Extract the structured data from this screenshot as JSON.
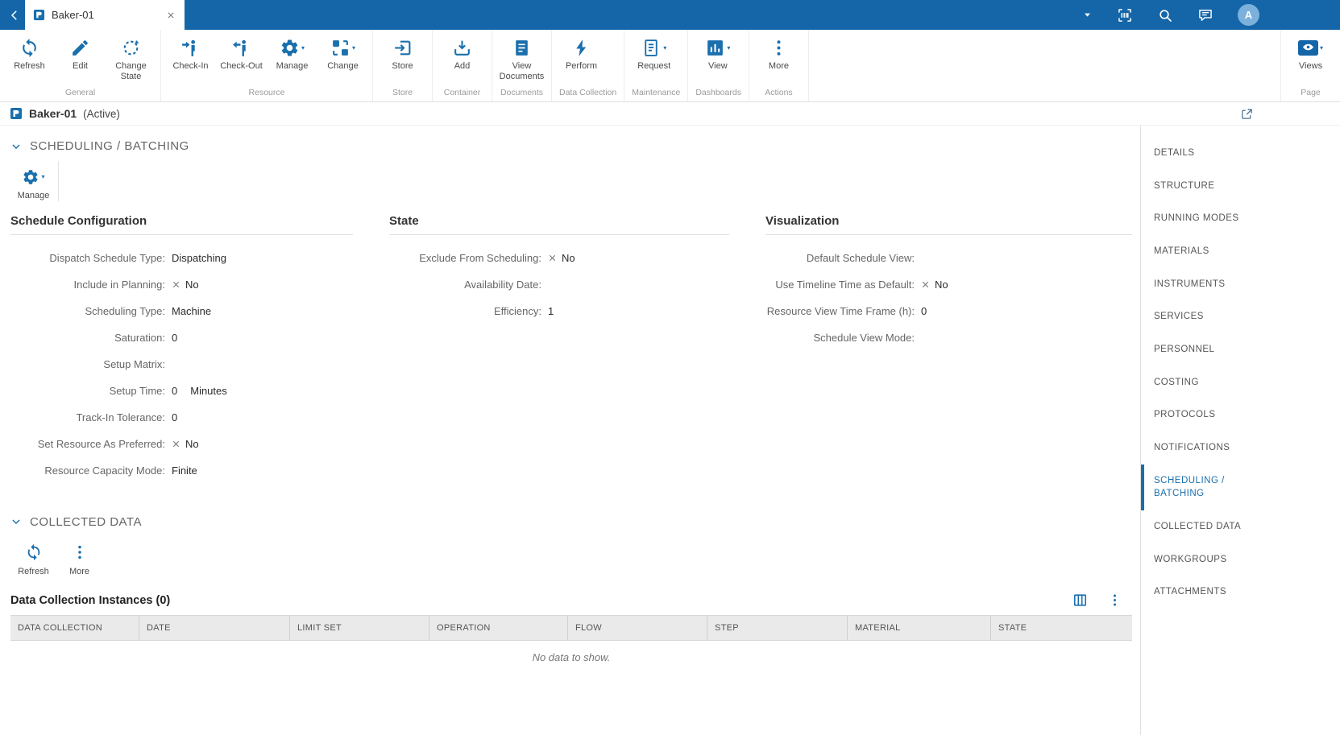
{
  "colors": {
    "accent": "#1a6fad",
    "topbar_bg": "#1566a8"
  },
  "topbar": {
    "tab_title": "Baker-01",
    "avatar_letter": "A",
    "icons": [
      "caret-down",
      "scan",
      "search",
      "chat"
    ]
  },
  "ribbon": {
    "groups": [
      {
        "label": "General",
        "buttons": [
          {
            "label": "Refresh",
            "icon": "refresh"
          },
          {
            "label": "Edit",
            "icon": "edit"
          },
          {
            "label": "Change State",
            "icon": "change-state"
          }
        ]
      },
      {
        "label": "Resource",
        "buttons": [
          {
            "label": "Check-In",
            "icon": "check-in"
          },
          {
            "label": "Check-Out",
            "icon": "check-out"
          },
          {
            "label": "Manage",
            "icon": "gear",
            "caret": true
          },
          {
            "label": "Change",
            "icon": "change",
            "caret": true
          }
        ]
      },
      {
        "label": "Store",
        "buttons": [
          {
            "label": "Store",
            "icon": "store"
          }
        ]
      },
      {
        "label": "Container",
        "buttons": [
          {
            "label": "Add",
            "icon": "add"
          }
        ]
      },
      {
        "label": "Documents",
        "buttons": [
          {
            "label": "View Documents",
            "icon": "documents"
          }
        ]
      },
      {
        "label": "Data Collection",
        "buttons": [
          {
            "label": "Perform",
            "icon": "perform"
          }
        ]
      },
      {
        "label": "Maintenance",
        "buttons": [
          {
            "label": "Request",
            "icon": "request",
            "caret": true
          }
        ]
      },
      {
        "label": "Dashboards",
        "buttons": [
          {
            "label": "View",
            "icon": "view-dashboard",
            "caret": true
          }
        ]
      },
      {
        "label": "Actions",
        "buttons": [
          {
            "label": "More",
            "icon": "more"
          }
        ]
      }
    ],
    "page_group": {
      "label": "Page",
      "button_label": "Views",
      "icon": "views",
      "caret": true
    }
  },
  "titlebar": {
    "title": "Baker-01",
    "status": "(Active)"
  },
  "sections": {
    "scheduling": {
      "title": "SCHEDULING / BATCHING",
      "toolbar": [
        {
          "label": "Manage",
          "icon": "gear",
          "caret": true
        }
      ],
      "columns": [
        {
          "title": "Schedule Configuration",
          "fields": [
            {
              "label": "Dispatch Schedule Type:",
              "value": "Dispatching"
            },
            {
              "label": "Include in Planning:",
              "value": "No",
              "x": true
            },
            {
              "label": "Scheduling Type:",
              "value": "Machine"
            },
            {
              "label": "Saturation:",
              "value": "0"
            },
            {
              "label": "Setup Matrix:",
              "value": ""
            },
            {
              "label": "Setup Time:",
              "value": "0",
              "unit": "Minutes"
            },
            {
              "label": "Track-In Tolerance:",
              "value": "0"
            },
            {
              "label": "Set Resource As Preferred:",
              "value": "No",
              "x": true
            },
            {
              "label": "Resource Capacity Mode:",
              "value": "Finite"
            }
          ]
        },
        {
          "title": "State",
          "fields": [
            {
              "label": "Exclude From Scheduling:",
              "value": "No",
              "x": true
            },
            {
              "label": "Availability Date:",
              "value": ""
            },
            {
              "label": "Efficiency:",
              "value": "1"
            }
          ]
        },
        {
          "title": "Visualization",
          "fields": [
            {
              "label": "Default Schedule View:",
              "value": ""
            },
            {
              "label": "Use Timeline Time as Default:",
              "value": "No",
              "x": true
            },
            {
              "label": "Resource View Time Frame (h):",
              "value": "0"
            },
            {
              "label": "Schedule View Mode:",
              "value": ""
            }
          ]
        }
      ]
    },
    "collected": {
      "title": "COLLECTED DATA",
      "toolbar": [
        {
          "label": "Refresh",
          "icon": "refresh"
        },
        {
          "label": "More",
          "icon": "more"
        }
      ],
      "table": {
        "title": "Data Collection Instances (0)",
        "columns": [
          "DATA COLLECTION",
          "DATE",
          "LIMIT SET",
          "OPERATION",
          "FLOW",
          "STEP",
          "MATERIAL",
          "STATE"
        ],
        "empty_text": "No data to show."
      }
    }
  },
  "sidebar": {
    "items": [
      {
        "label": "DETAILS"
      },
      {
        "label": "STRUCTURE"
      },
      {
        "label": "RUNNING MODES"
      },
      {
        "label": "MATERIALS"
      },
      {
        "label": "INSTRUMENTS"
      },
      {
        "label": "SERVICES"
      },
      {
        "label": "PERSONNEL"
      },
      {
        "label": "COSTING"
      },
      {
        "label": "PROTOCOLS"
      },
      {
        "label": "NOTIFICATIONS"
      },
      {
        "label": "SCHEDULING / BATCHING",
        "active": true
      },
      {
        "label": "COLLECTED DATA"
      },
      {
        "label": "WORKGROUPS"
      },
      {
        "label": "ATTACHMENTS"
      }
    ]
  }
}
